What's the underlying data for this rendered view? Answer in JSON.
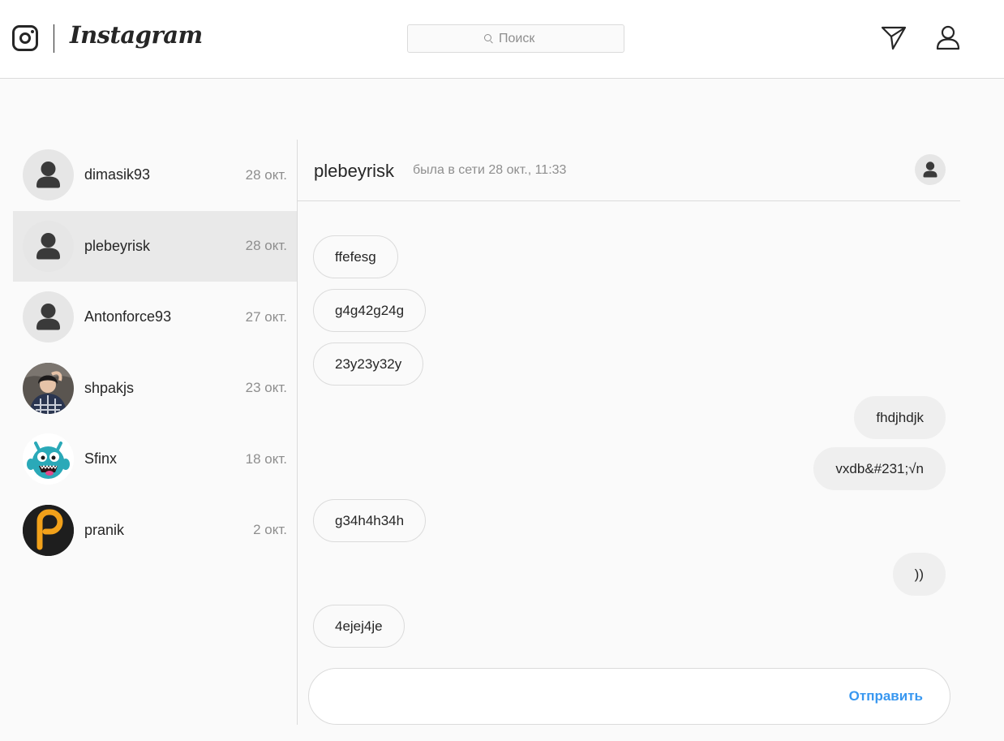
{
  "header": {
    "wordmark": "Instagram",
    "search": {
      "placeholder": "Поиск",
      "value": ""
    }
  },
  "conversations": [
    {
      "name": "dimasik93",
      "date": "28 окт.",
      "avatar": "default-avatar",
      "active": false
    },
    {
      "name": "plebeyrisk",
      "date": "28 окт.",
      "avatar": "default-avatar",
      "active": true
    },
    {
      "name": "Antonforce93",
      "date": "27 окт.",
      "avatar": "default-avatar",
      "active": false
    },
    {
      "name": "shpakjs",
      "date": "23 окт.",
      "avatar": "photo-avatar",
      "active": false
    },
    {
      "name": "Sfinx",
      "date": "18 окт.",
      "avatar": "blue-monster-avatar",
      "active": false
    },
    {
      "name": "pranik",
      "date": "2 окт.",
      "avatar": "p-letter-avatar",
      "active": false
    }
  ],
  "chat": {
    "title": "plebeyrisk",
    "status": "былa в сети 28 окт., 11:33",
    "messages": [
      {
        "text": "ffefesg",
        "direction": "incoming"
      },
      {
        "text": "g4g42g24g",
        "direction": "incoming"
      },
      {
        "text": "23y23y32y",
        "direction": "incoming"
      },
      {
        "text": "fhdjhdjk",
        "direction": "outgoing"
      },
      {
        "text": "vxdb&#231;√n",
        "direction": "outgoing"
      },
      {
        "text": "g34h4h34h",
        "direction": "incoming"
      },
      {
        "text": "))",
        "direction": "outgoing"
      },
      {
        "text": "4ejej4je",
        "direction": "incoming"
      }
    ]
  },
  "composer": {
    "value": "",
    "placeholder": "",
    "send_label": "Отправить"
  },
  "colors": {
    "accent": "#3897f0",
    "border": "#dbdbdb",
    "background": "#fafafa",
    "active_row": "#e9e9e9",
    "muted_text": "#8e8e8e"
  }
}
